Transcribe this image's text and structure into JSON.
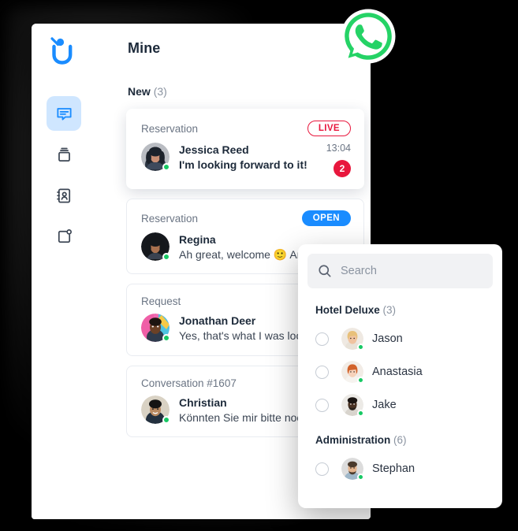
{
  "brand": {
    "logo_icon": "userlike-u-logo",
    "name": "Userlike"
  },
  "sidebar": {
    "items": [
      {
        "icon": "chat-bubble-icon",
        "name": "messages",
        "active": true
      },
      {
        "icon": "archive-box-icon",
        "name": "archive",
        "active": false
      },
      {
        "icon": "contact-book-icon",
        "name": "contacts",
        "active": false
      },
      {
        "icon": "new-conversation-icon",
        "name": "new-conversation",
        "active": false
      }
    ]
  },
  "header": {
    "title": "Mine",
    "back_icon": "chevron-left-icon"
  },
  "section": {
    "label": "New",
    "count": "(3)"
  },
  "conversations": [
    {
      "kind": "Reservation",
      "status_badge": "LIVE",
      "status_type": "live",
      "name": "Jessica Reed",
      "message": "I'm looking forward to it!",
      "time": "13:04",
      "unread": "2",
      "online": true,
      "unread_color": "#e8173d"
    },
    {
      "kind": "Reservation",
      "status_badge": "OPEN",
      "status_type": "open",
      "name": "Regina",
      "message": "Ah great, welcome 🙂 Are you...",
      "time": "",
      "unread": "",
      "online": true,
      "unread_color": "#1a8cff"
    },
    {
      "kind": "Request",
      "status_badge": "",
      "status_type": "none",
      "name": "Jonathan Deer",
      "message": "Yes, that's what I was looking...",
      "time": "",
      "unread": "",
      "online": true,
      "unread_color": ""
    },
    {
      "kind": "Conversation #1607",
      "status_badge": "",
      "status_type": "none",
      "name": "Christian",
      "message": "Könnten Sie mir bitte noch d...",
      "time": "",
      "unread": "",
      "online": true,
      "unread_color": ""
    }
  ],
  "assign_panel": {
    "search": {
      "icon": "search-icon",
      "placeholder": "Search",
      "value": ""
    },
    "groups": [
      {
        "label": "Hotel Deluxe",
        "count": "(3)",
        "people": [
          {
            "name": "Jason",
            "online": true,
            "selected": false
          },
          {
            "name": "Anastasia",
            "online": true,
            "selected": false
          },
          {
            "name": "Jake",
            "online": true,
            "selected": false
          }
        ]
      },
      {
        "label": "Administration",
        "count": "(6)",
        "people": [
          {
            "name": "Stephan",
            "online": true,
            "selected": false
          }
        ]
      }
    ]
  },
  "channel_badge": {
    "icon": "whatsapp-logo",
    "name": "WhatsApp",
    "color": "#25D366"
  },
  "colors": {
    "accent_blue": "#1a8cff",
    "live_red": "#e8173d",
    "online_green": "#17c964",
    "whatsapp_green": "#25D366",
    "text_dark": "#1d2a3a",
    "text_muted": "#6b7584",
    "background": "#000000"
  }
}
